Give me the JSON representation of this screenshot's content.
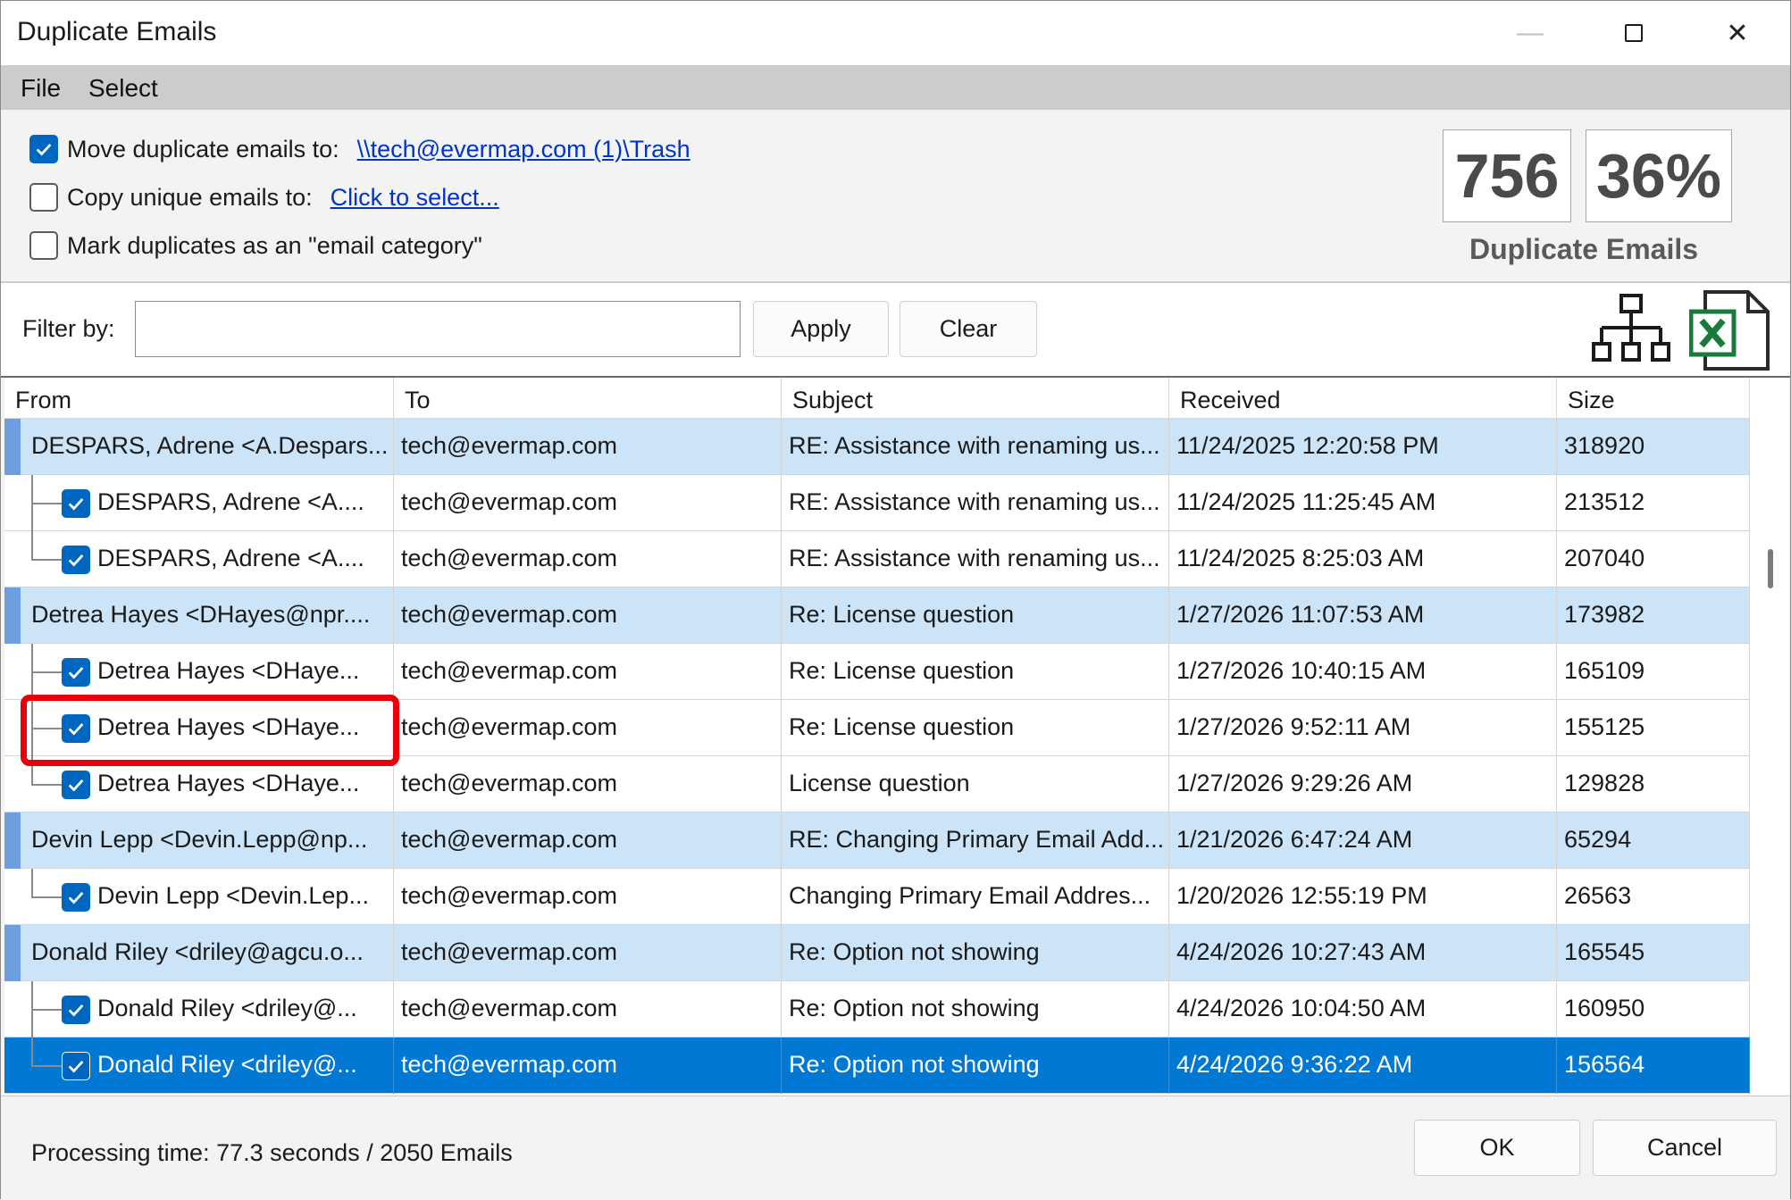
{
  "window": {
    "title": "Duplicate Emails",
    "minimize": "—",
    "close": "✕"
  },
  "menu": [
    "File",
    "Select"
  ],
  "options": {
    "move": {
      "label": "Move duplicate emails to:",
      "checked": true,
      "link": "\\\\tech@evermap.com (1)\\Trash"
    },
    "copy": {
      "label": "Copy unique emails to:",
      "checked": false,
      "link": "Click to select..."
    },
    "mark": {
      "label": "Mark duplicates as an \"email category\"",
      "checked": false
    }
  },
  "stats": {
    "count": "756",
    "percent": "36%",
    "label": "Duplicate Emails"
  },
  "filter": {
    "label": "Filter by:",
    "value": "",
    "apply": "Apply",
    "clear": "Clear",
    "tree_icon": "hierarchy-icon",
    "excel_icon": "excel-icon"
  },
  "grid": {
    "columns": [
      "From",
      "To",
      "Subject",
      "Received",
      "Size"
    ],
    "rows": [
      {
        "type": "group",
        "from": "DESPARS, Adrene <A.Despars...",
        "to": "tech@evermap.com",
        "subject": "RE: Assistance with renaming us...",
        "received": "11/24/2025 12:20:58 PM",
        "size": "318920"
      },
      {
        "type": "child",
        "from": "DESPARS, Adrene <A....",
        "to": "tech@evermap.com",
        "subject": "RE: Assistance with renaming us...",
        "received": "11/24/2025 11:25:45 AM",
        "size": "213512"
      },
      {
        "type": "child",
        "from": "DESPARS, Adrene <A....",
        "to": "tech@evermap.com",
        "subject": "RE: Assistance with renaming us...",
        "received": "11/24/2025 8:25:03 AM",
        "size": "207040"
      },
      {
        "type": "group",
        "from": "Detrea Hayes <DHayes@npr....",
        "to": "tech@evermap.com",
        "subject": "Re: License question",
        "received": "1/27/2026 11:07:53 AM",
        "size": "173982"
      },
      {
        "type": "child",
        "from": "Detrea Hayes <DHaye...",
        "to": "tech@evermap.com",
        "subject": "Re: License question",
        "received": "1/27/2026 10:40:15 AM",
        "size": "165109"
      },
      {
        "type": "child",
        "from": "Detrea Hayes <DHaye...",
        "to": "tech@evermap.com",
        "subject": "Re: License question",
        "received": "1/27/2026 9:52:11 AM",
        "size": "155125"
      },
      {
        "type": "child",
        "from": "Detrea Hayes <DHaye...",
        "to": "tech@evermap.com",
        "subject": "License question",
        "received": "1/27/2026 9:29:26 AM",
        "size": "129828"
      },
      {
        "type": "group",
        "from": "Devin Lepp <Devin.Lepp@np...",
        "to": "tech@evermap.com",
        "subject": "RE: Changing Primary Email Add...",
        "received": "1/21/2026 6:47:24 AM",
        "size": "65294"
      },
      {
        "type": "child",
        "from": "Devin Lepp <Devin.Lep...",
        "to": "tech@evermap.com",
        "subject": "Changing Primary Email Addres...",
        "received": "1/20/2026 12:55:19 PM",
        "size": "26563"
      },
      {
        "type": "group",
        "from": "Donald Riley <driley@agcu.o...",
        "to": "tech@evermap.com",
        "subject": "Re: Option not showing",
        "received": "4/24/2026 10:27:43 AM",
        "size": "165545"
      },
      {
        "type": "child",
        "from": "Donald Riley <driley@...",
        "to": "tech@evermap.com",
        "subject": "Re: Option not showing",
        "received": "4/24/2026 10:04:50 AM",
        "size": "160950"
      },
      {
        "type": "child-selected",
        "from": "Donald Riley <driley@...",
        "to": "tech@evermap.com",
        "subject": "Re: Option not showing",
        "received": "4/24/2026 9:36:22 AM",
        "size": "156564"
      }
    ]
  },
  "footer": {
    "status": "Processing time: 77.3 seconds / 2050 Emails",
    "ok": "OK",
    "cancel": "Cancel"
  },
  "colors": {
    "group_row": "#cce4f7",
    "selected_row": "#0078d4",
    "checkbox": "#0067c0",
    "highlight": "#e8000b"
  }
}
